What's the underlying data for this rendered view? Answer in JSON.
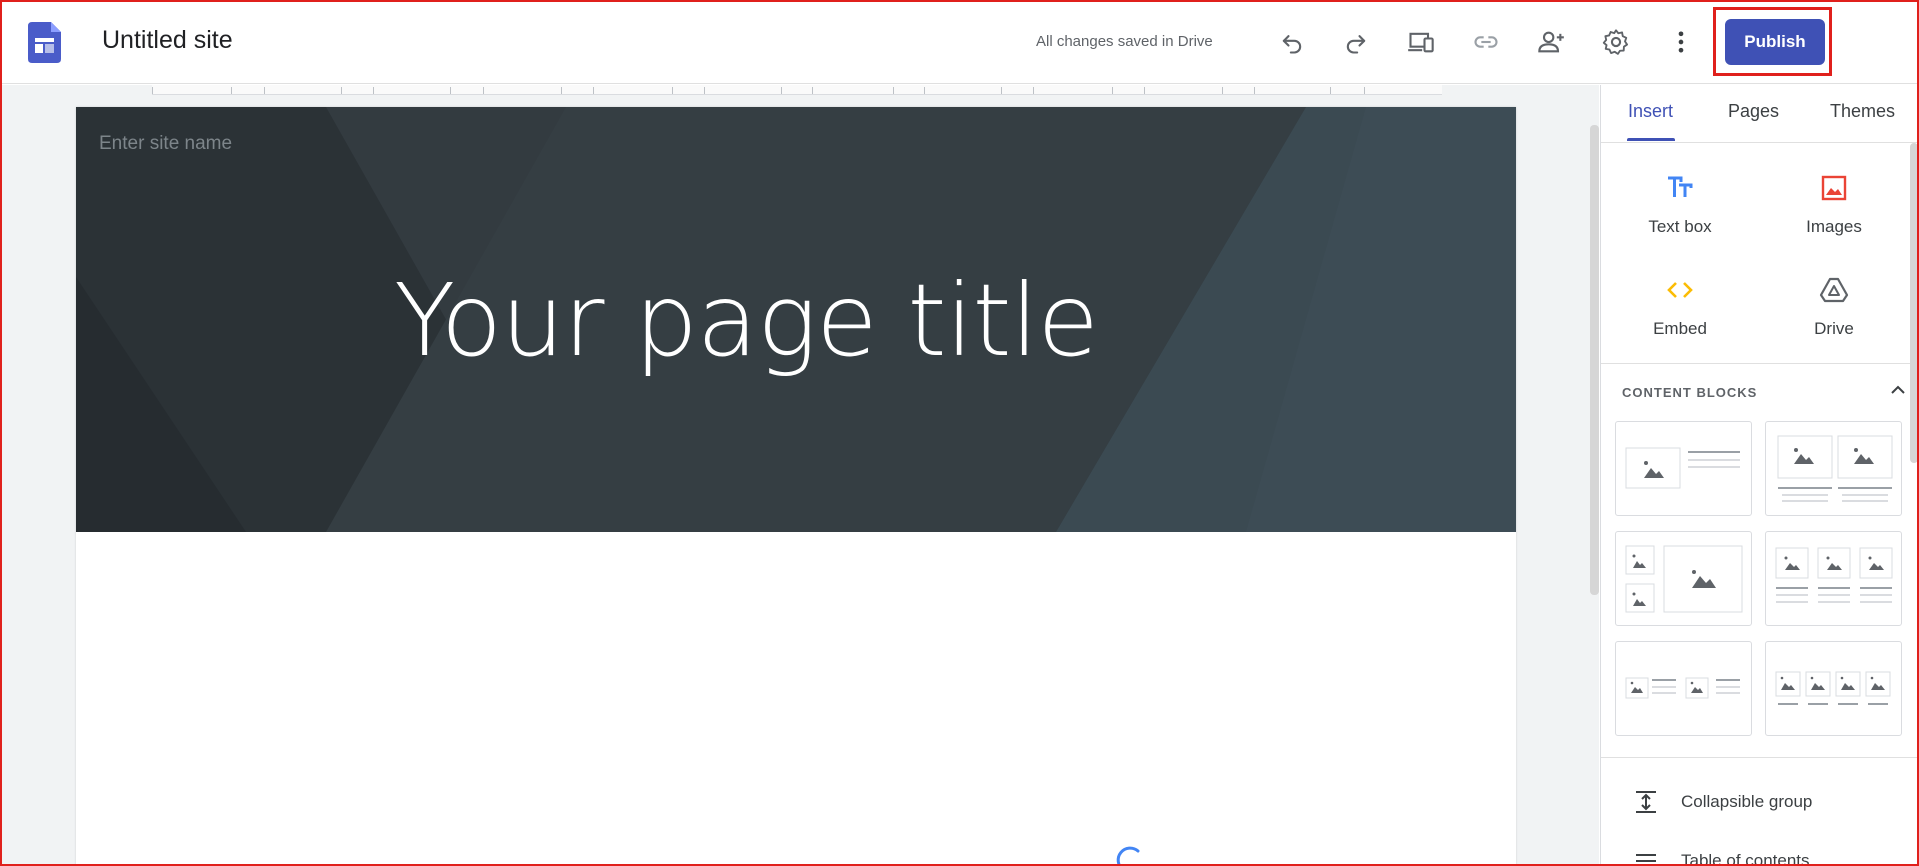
{
  "header": {
    "site_title": "Untitled site",
    "save_status": "All changes saved in Drive",
    "publish_label": "Publish",
    "icons": [
      "undo-icon",
      "redo-icon",
      "preview-devices-icon",
      "link-icon",
      "add-person-icon",
      "gear-icon",
      "more-vert-icon"
    ]
  },
  "page": {
    "site_name_placeholder": "Enter site name",
    "title": "Your page title"
  },
  "panel": {
    "tabs": [
      {
        "label": "Insert",
        "active": true
      },
      {
        "label": "Pages",
        "active": false
      },
      {
        "label": "Themes",
        "active": false
      }
    ],
    "insert_items": [
      {
        "label": "Text box",
        "icon": "text-box-icon",
        "color": "#4285f4"
      },
      {
        "label": "Images",
        "icon": "image-icon",
        "color": "#ea4335"
      },
      {
        "label": "Embed",
        "icon": "embed-icon",
        "color": "#fbbc04"
      },
      {
        "label": "Drive",
        "icon": "drive-icon",
        "color": "#5f6368"
      }
    ],
    "content_blocks_title": "CONTENT BLOCKS",
    "list_items": [
      {
        "label": "Collapsible group",
        "icon": "collapsible-group-icon"
      },
      {
        "label": "Table of contents",
        "icon": "table-of-contents-icon"
      }
    ]
  },
  "colors": {
    "accent": "#3f51b5",
    "highlight": "#e0201c",
    "hero_background": "#333b40"
  }
}
